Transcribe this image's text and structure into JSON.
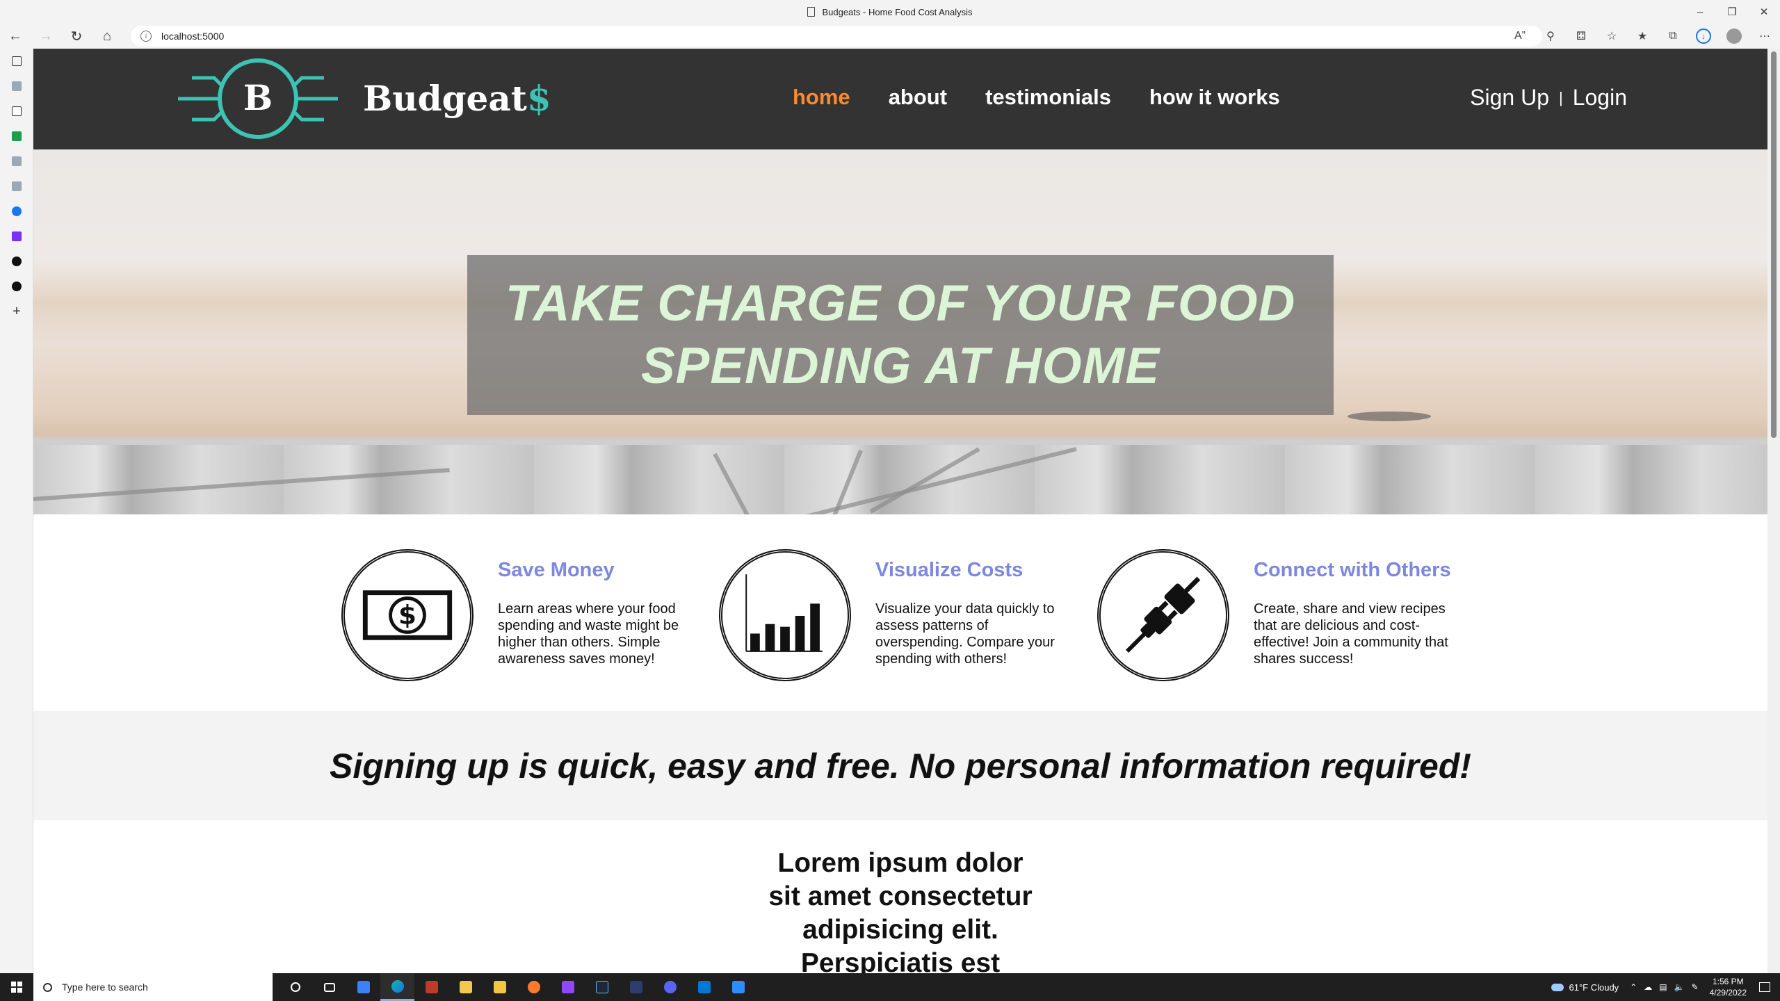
{
  "window": {
    "title": "Budgeats - Home Food Cost Analysis"
  },
  "browser": {
    "url": "localhost:5000"
  },
  "site": {
    "logo_letter": "B",
    "brand_name": "Budgeat",
    "brand_accent": "$",
    "nav": [
      {
        "label": "home",
        "active": true
      },
      {
        "label": "about",
        "active": false
      },
      {
        "label": "testimonials",
        "active": false
      },
      {
        "label": "how it works",
        "active": false
      }
    ],
    "auth": {
      "signup": "Sign Up",
      "separator": "|",
      "login": "Login"
    }
  },
  "hero": {
    "line1": "TAKE CHARGE OF YOUR FOOD",
    "line2": "SPENDING AT HOME"
  },
  "features": [
    {
      "title": "Save Money",
      "icon": "dollar-bill-icon",
      "description": "Learn areas where your food spending and waste might be higher than others. Simple awareness saves money!"
    },
    {
      "title": "Visualize Costs",
      "icon": "bar-chart-icon",
      "description": "Visualize your data quickly to assess patterns of overspending. Compare your spending with others!"
    },
    {
      "title": "Connect with Others",
      "icon": "plug-connect-icon",
      "description": "Create, share and view recipes that are delicious and cost-effective! Join a community that shares success!"
    }
  ],
  "signup_band": "Signing up is quick, easy and free. No personal information required!",
  "lorem": "Lorem ipsum dolor sit amet consectetur adipisicing elit. Perspiciatis est",
  "taskbar": {
    "search_placeholder": "Type here to search",
    "weather": "61°F  Cloudy",
    "time": "1:56 PM",
    "date": "4/29/2022"
  },
  "colors": {
    "header_bg": "#333333",
    "nav_active": "#ff8a2b",
    "brand_accent": "#3cc3b3",
    "feature_title": "#7d87e0",
    "hero_text": "#dbf5d6"
  }
}
